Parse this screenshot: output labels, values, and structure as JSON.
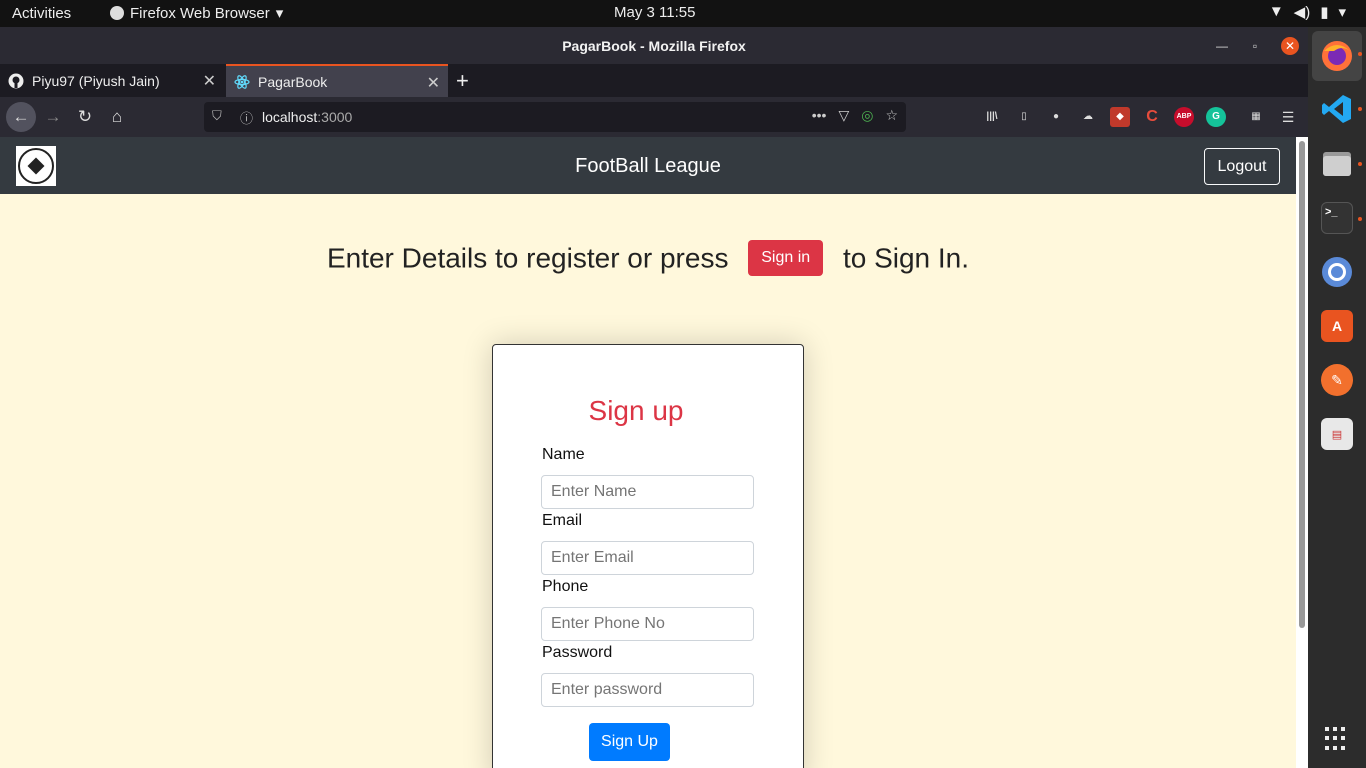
{
  "system": {
    "activities": "Activities",
    "app_menu": "Firefox Web Browser",
    "clock": "May 3  11:55"
  },
  "window": {
    "title": "PagarBook - Mozilla Firefox"
  },
  "tabs": [
    {
      "label": "Piyu97 (Piyush Jain)",
      "icon": "github-icon"
    },
    {
      "label": "PagarBook",
      "icon": "react-icon"
    }
  ],
  "urlbar": {
    "host": "localhost",
    "port": ":3000"
  },
  "extensions": [
    {
      "name": "library-icon",
      "text": "|||\\",
      "color": "#2b2a33"
    },
    {
      "name": "sidebar-icon",
      "text": "▯",
      "color": "#2b2a33"
    },
    {
      "name": "account-icon",
      "text": "●",
      "color": "#2b2a33"
    },
    {
      "name": "extension-cloud-icon",
      "text": "☁",
      "color": "#2b2a33"
    },
    {
      "name": "extension-red-icon",
      "text": "◆",
      "color": "#c0392b"
    },
    {
      "name": "extension-c-icon",
      "text": "C",
      "color": "#e74c3c"
    },
    {
      "name": "adblock-icon",
      "text": "ABP",
      "color": "#c70d2c"
    },
    {
      "name": "grammarly-icon",
      "text": "G",
      "color": "#15c39a"
    }
  ],
  "app": {
    "brand": "FootBall League",
    "logout": "Logout",
    "prompt_before": "Enter Details to register or press",
    "signin_button": "Sign in",
    "prompt_after": "to Sign In."
  },
  "form": {
    "title": "Sign up",
    "name_label": "Name",
    "name_placeholder": "Enter Name",
    "email_label": "Email",
    "email_placeholder": "Enter Email",
    "phone_label": "Phone",
    "phone_placeholder": "Enter Phone No",
    "password_label": "Password",
    "password_placeholder": "Enter password",
    "submit": "Sign Up"
  },
  "colors": {
    "page_background": "#fff8dc",
    "navbar": "#343a40",
    "danger": "#dc3545",
    "primary": "#007bff",
    "ubuntu_orange": "#e95420"
  }
}
